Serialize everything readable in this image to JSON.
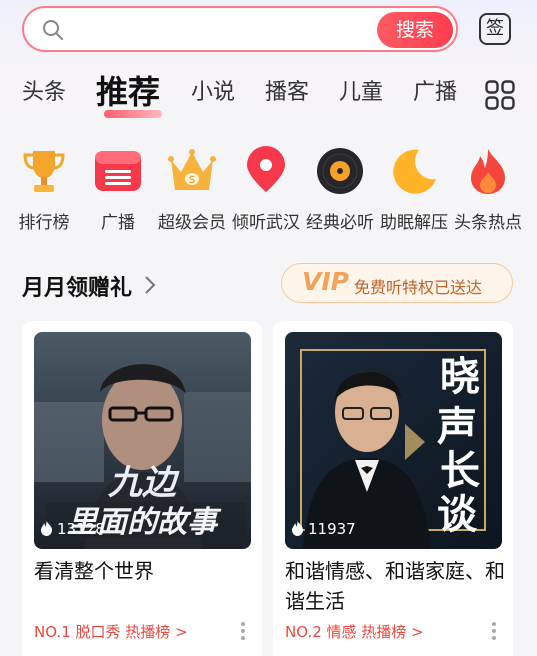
{
  "search": {
    "placeholder": "",
    "button_label": "搜索"
  },
  "sign_label": "签",
  "tabs": [
    {
      "label": "头条",
      "active": false
    },
    {
      "label": "推荐",
      "active": true
    },
    {
      "label": "小说",
      "active": false
    },
    {
      "label": "播客",
      "active": false
    },
    {
      "label": "儿童",
      "active": false
    },
    {
      "label": "广播",
      "active": false
    }
  ],
  "quick_icons": [
    {
      "label": "排行榜",
      "icon": "trophy-icon"
    },
    {
      "label": "广播",
      "icon": "radio-icon"
    },
    {
      "label": "超级会员",
      "icon": "crown-icon"
    },
    {
      "label": "倾听武汉",
      "icon": "location-pin-icon"
    },
    {
      "label": "经典必听",
      "icon": "vinyl-record-icon"
    },
    {
      "label": "助眠解压",
      "icon": "moon-icon"
    },
    {
      "label": "头条热点",
      "icon": "flame-icon"
    }
  ],
  "section": {
    "title": "月月领赠礼",
    "vip_badge": "VIP",
    "vip_text": "免费听特权已送达"
  },
  "cards": [
    {
      "cover_text": "九边 里面的故事",
      "plays": "13128",
      "title": "看清整个世界",
      "rank": "NO.1 脱口秀 热播榜 >"
    },
    {
      "cover_text": "晓声长谈",
      "plays": "11937",
      "title": "和谐情感、和谐家庭、和谐生活",
      "rank": "NO.2 情感 热播榜 >"
    }
  ],
  "colors": {
    "accent": "#ff4354",
    "rank": "#f0483e",
    "vip_gold": "#f2a35a"
  }
}
